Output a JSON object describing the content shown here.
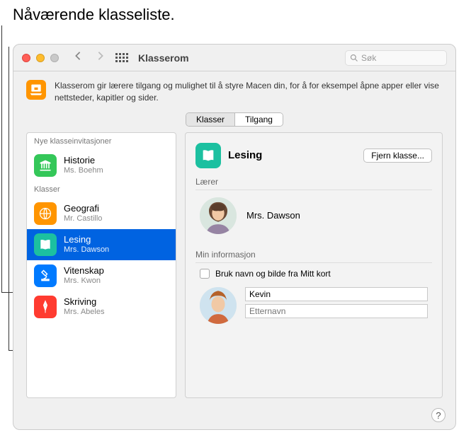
{
  "annotation": "Nåværende klasseliste.",
  "window": {
    "title": "Klasserom",
    "search_placeholder": "Søk"
  },
  "description": "Klasserom gir lærere tilgang og mulighet til å styre Macen din, for å for eksempel åpne apper eller vise nettsteder, kapitler og sider.",
  "tabs": {
    "classes": "Klasser",
    "access": "Tilgang"
  },
  "sidebar": {
    "invitations_header": "Nye klasseinvitasjoner",
    "classes_header": "Klasser",
    "items": [
      {
        "title": "Historie",
        "sub": "Ms. Boehm",
        "color": "#34c759",
        "icon": "columns"
      },
      {
        "title": "Geografi",
        "sub": "Mr. Castillo",
        "color": "#ff9500",
        "icon": "globe"
      },
      {
        "title": "Lesing",
        "sub": "Mrs. Dawson",
        "color": "#1cc0a0",
        "icon": "book"
      },
      {
        "title": "Vitenskap",
        "sub": "Mrs. Kwon",
        "color": "#007aff",
        "icon": "microscope"
      },
      {
        "title": "Skriving",
        "sub": "Mrs. Abeles",
        "color": "#ff3b30",
        "icon": "pen"
      }
    ]
  },
  "detail": {
    "title": "Lesing",
    "remove": "Fjern klasse...",
    "teacher_label": "Lærer",
    "teacher_name": "Mrs. Dawson",
    "myinfo_label": "Min informasjon",
    "checkbox_label": "Bruk navn og bilde fra Mitt kort",
    "firstname": "Kevin",
    "lastname_placeholder": "Etternavn"
  }
}
